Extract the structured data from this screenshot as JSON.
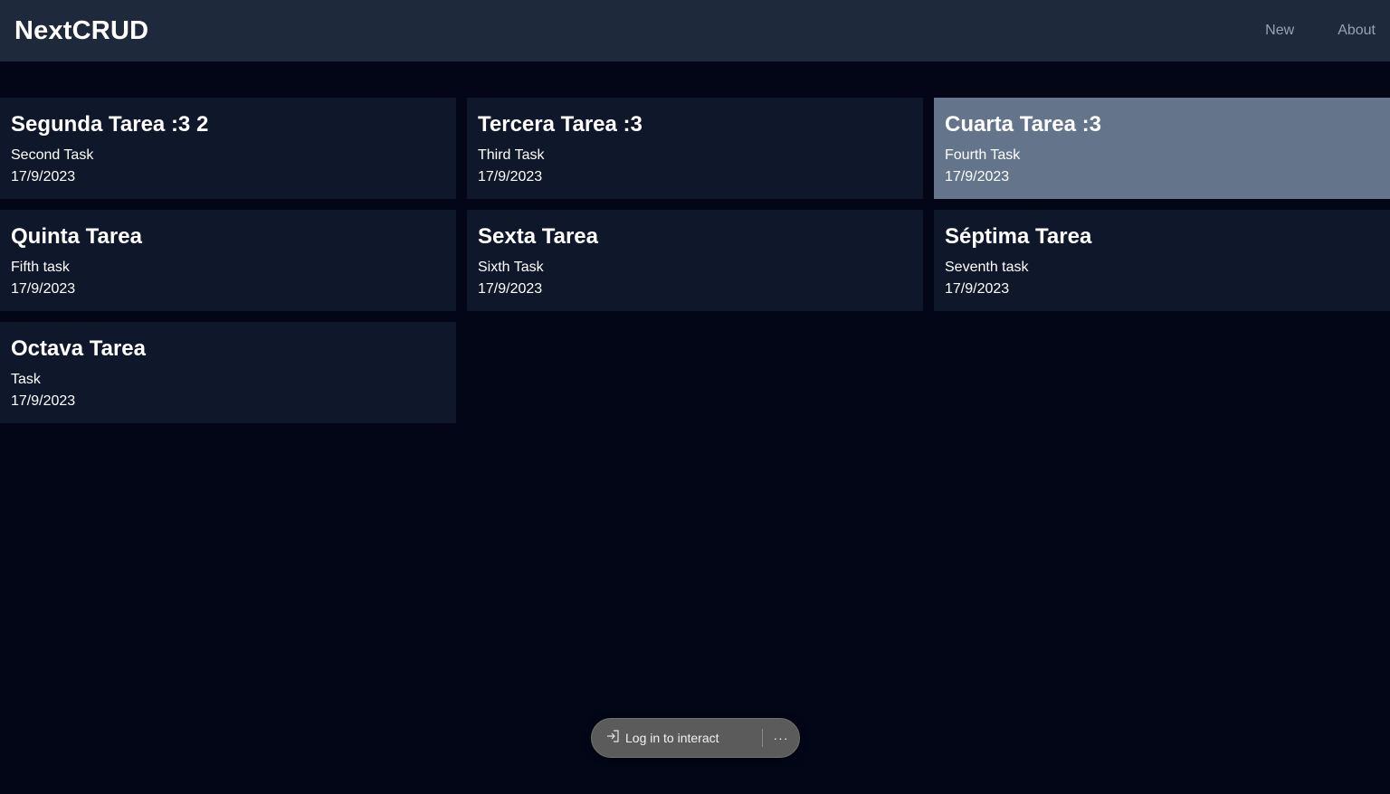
{
  "navbar": {
    "brand": "NextCRUD",
    "links": [
      "New",
      "About"
    ]
  },
  "tasks": [
    {
      "title": "Segunda Tarea :3 2",
      "description": "Second Task",
      "date": "17/9/2023"
    },
    {
      "title": "Tercera Tarea :3",
      "description": "Third Task",
      "date": "17/9/2023"
    },
    {
      "title": "Cuarta Tarea :3",
      "description": "Fourth Task",
      "date": "17/9/2023"
    },
    {
      "title": "Quinta Tarea",
      "description": "Fifth task",
      "date": "17/9/2023"
    },
    {
      "title": "Sexta Tarea",
      "description": "Sixth Task",
      "date": "17/9/2023"
    },
    {
      "title": "Séptima Tarea",
      "description": "Seventh task",
      "date": "17/9/2023"
    },
    {
      "title": "Octava Tarea",
      "description": "Task",
      "date": "17/9/2023"
    }
  ],
  "overlay": {
    "login_label": "Log in to interact",
    "more_label": "···",
    "login_icon": "login-arrow-icon"
  },
  "colors": {
    "background": "#020617",
    "navbar": "#1e293b",
    "card": "#0f172a",
    "card_hover": "#64748b",
    "nav_link": "#94a3b8"
  }
}
